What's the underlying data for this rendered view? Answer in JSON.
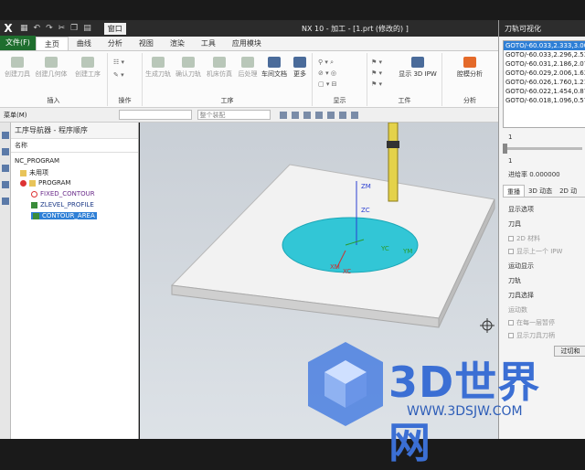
{
  "titlebar": {
    "window_label": "窗口",
    "title": "NX 10 - 加工 - [1.prt (修改的) ]"
  },
  "menu": {
    "file": "文件(F)",
    "tabs": [
      "主页",
      "曲线",
      "分析",
      "视图",
      "渲染",
      "工具",
      "应用模块"
    ]
  },
  "ribbon": {
    "buttons": [
      "创建刀具",
      "创建几何体",
      "创建工序",
      "生成刀轨",
      "确认刀轨",
      "机床仿真",
      "后处理",
      "车间文档",
      "更多",
      "显示 3D IPW",
      "腔模分析"
    ],
    "group_labels": [
      "插入",
      "操作",
      "工序",
      "显示",
      "工件",
      "分析"
    ]
  },
  "subbar": {
    "menu_label": "菜单(M)",
    "filter_label": "整个装配"
  },
  "navigator": {
    "title": "工序导航器 - 程序顺序",
    "column_header": "名称",
    "items": [
      "NC_PROGRAM",
      "未用项",
      "PROGRAM",
      "FIXED_CONTOUR",
      "ZLEVEL_PROFILE",
      "CONTOUR_AREA"
    ]
  },
  "viewport": {
    "axis_zm": "ZM",
    "axis_zc": "ZC",
    "axis_yc": "YC",
    "axis_ym": "YM",
    "axis_xc": "XC",
    "axis_xm": "XM"
  },
  "right_panel": {
    "title": "刀轨可视化",
    "goto_list": [
      "GOTO/-60.033,2.333,3.000",
      "GOTO/-60.033,2.296,2.537",
      "GOTO/-60.031,2.186,2.073",
      "GOTO/-60.029,2.006,1.630",
      "GOTO/-60.026,1.760,1.212",
      "GOTO/-60.022,1.454,0.879",
      "GOTO/-60.018,1.096,0.571"
    ],
    "slider_top_label": "1",
    "slider_bottom_label": "1",
    "feed_label": "进给率 0.000000",
    "tabs": [
      "重播",
      "3D 动态",
      "2D 动"
    ],
    "display_options": "显示选项",
    "tool_label": "刀具",
    "check_2d_material": "2D 材料",
    "check_show_prev_ipw": "显示上一个 IPW",
    "motion_display": "运动显示",
    "toolpath_label": "刀轨",
    "toolpath_select": "刀具选择",
    "motion_count": "运动数",
    "check_pause_each": "在每一层暂停",
    "check_show_tool_shank": "显示刀具刀柄",
    "button_gouge": "过切和"
  },
  "watermark": {
    "text": "3D世界网",
    "url": "WWW.3DSJW.COM"
  }
}
